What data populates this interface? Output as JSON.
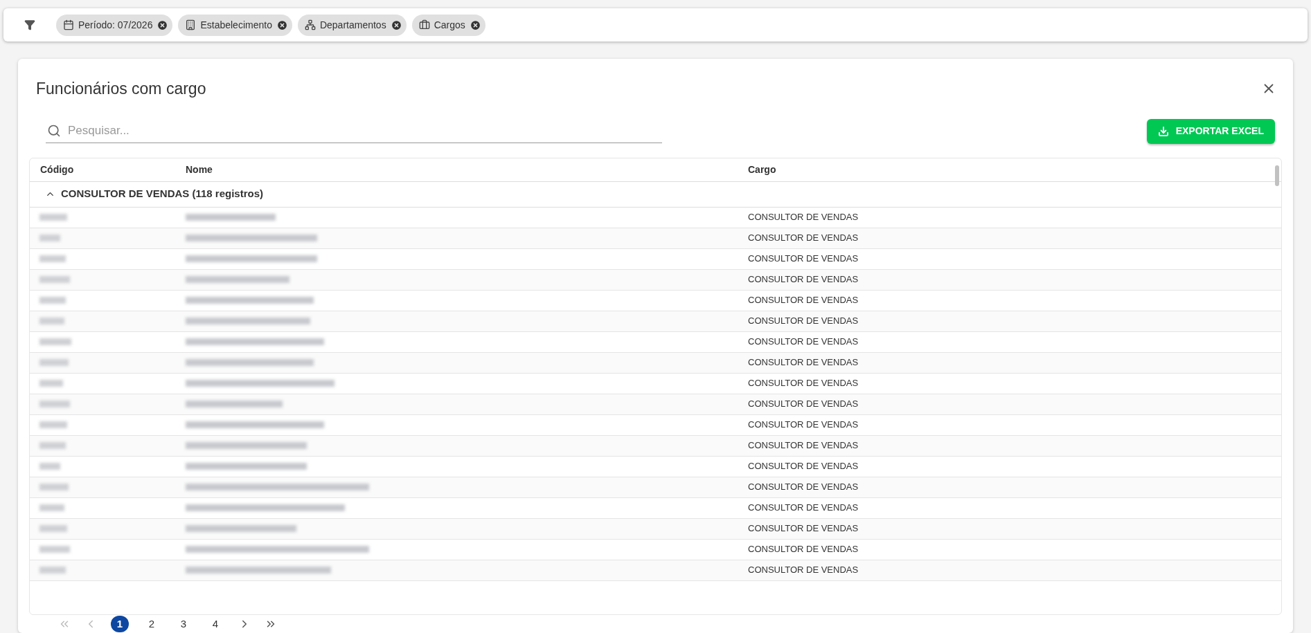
{
  "filters": [
    {
      "kind": "calendar",
      "label": "Período: 07/2026"
    },
    {
      "kind": "building",
      "label": "Estabelecimento"
    },
    {
      "kind": "tree",
      "label": "Departamentos"
    },
    {
      "kind": "briefcase",
      "label": "Cargos"
    }
  ],
  "dialog": {
    "title": "Funcionários com cargo"
  },
  "search": {
    "placeholder": "Pesquisar..."
  },
  "export_button": "EXPORTAR EXCEL",
  "table": {
    "columns": [
      "Código",
      "Nome",
      "Cargo"
    ],
    "group": {
      "label": "CONSULTOR DE VENDAS (118 registros)",
      "expanded": true
    },
    "rows": [
      {
        "cargo": "CONSULTOR DE VENDAS"
      },
      {
        "cargo": "CONSULTOR DE VENDAS"
      },
      {
        "cargo": "CONSULTOR DE VENDAS"
      },
      {
        "cargo": "CONSULTOR DE VENDAS"
      },
      {
        "cargo": "CONSULTOR DE VENDAS"
      },
      {
        "cargo": "CONSULTOR DE VENDAS"
      },
      {
        "cargo": "CONSULTOR DE VENDAS"
      },
      {
        "cargo": "CONSULTOR DE VENDAS"
      },
      {
        "cargo": "CONSULTOR DE VENDAS"
      },
      {
        "cargo": "CONSULTOR DE VENDAS"
      },
      {
        "cargo": "CONSULTOR DE VENDAS"
      },
      {
        "cargo": "CONSULTOR DE VENDAS"
      },
      {
        "cargo": "CONSULTOR DE VENDAS"
      },
      {
        "cargo": "CONSULTOR DE VENDAS"
      },
      {
        "cargo": "CONSULTOR DE VENDAS"
      },
      {
        "cargo": "CONSULTOR DE VENDAS"
      },
      {
        "cargo": "CONSULTOR DE VENDAS"
      },
      {
        "cargo": "CONSULTOR DE VENDAS"
      }
    ]
  },
  "pagination": {
    "pages": [
      {
        "label": "1",
        "selected": true
      },
      {
        "label": "2",
        "selected": false
      },
      {
        "label": "3",
        "selected": false
      },
      {
        "label": "4",
        "selected": false
      }
    ]
  }
}
